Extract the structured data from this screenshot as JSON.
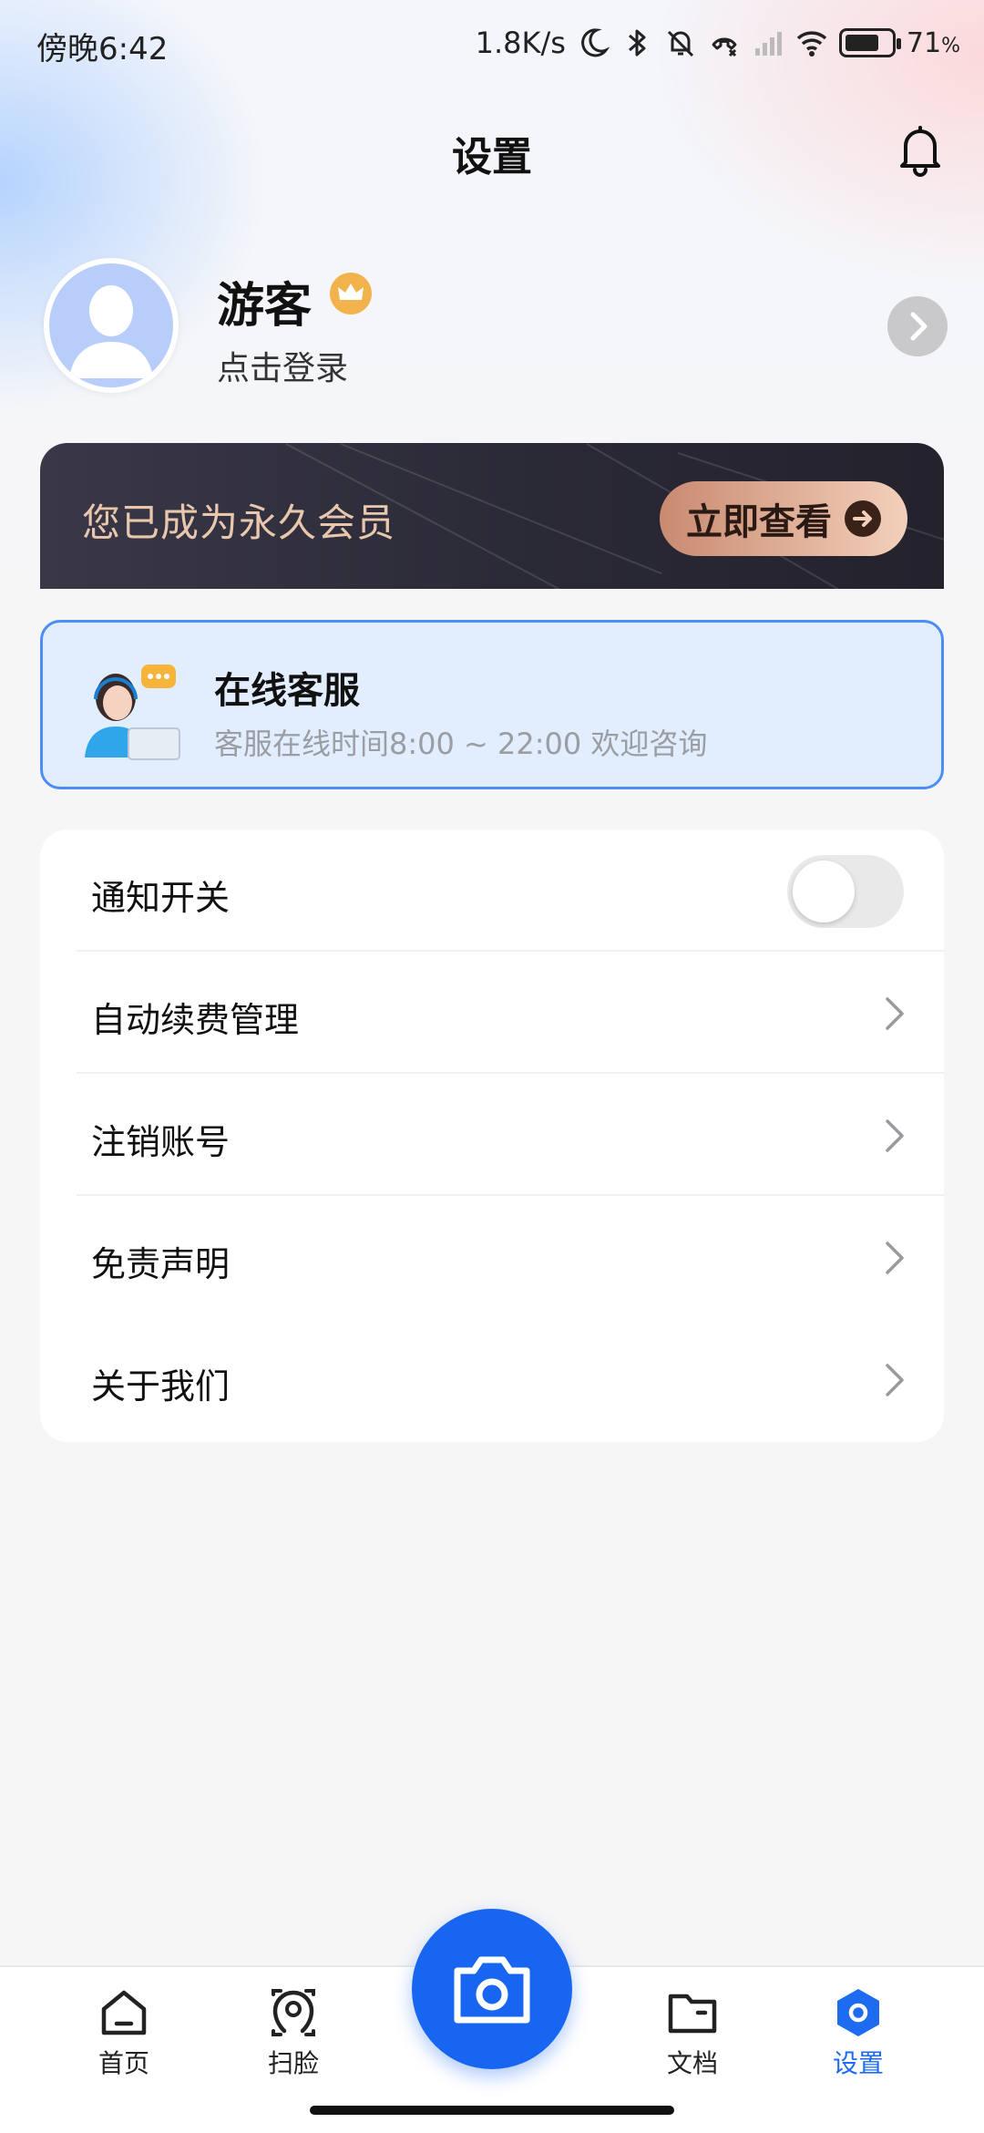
{
  "status_bar": {
    "time": "傍晚6:42",
    "net_speed": "1.8K/s",
    "battery_pct": "71",
    "battery_unit": "%",
    "battery_level": 0.71,
    "icons": [
      "moon-icon",
      "bluetooth-icon",
      "mute-bell-icon",
      "call-off-icon",
      "signal-icon",
      "wifi-icon",
      "battery-icon"
    ]
  },
  "header": {
    "title": "设置",
    "bell_icon": "bell-icon"
  },
  "profile": {
    "name": "游客",
    "login_prompt": "点击登录",
    "badge_icon": "crown-icon"
  },
  "vip_banner": {
    "text": "您已成为永久会员",
    "button_label": "立即查看"
  },
  "service": {
    "title": "在线客服",
    "subtitle": "客服在线时间8:00 ~ 22:00 欢迎咨询"
  },
  "settings": {
    "items": [
      {
        "label": "通知开关",
        "type": "toggle",
        "on": false
      },
      {
        "label": "自动续费管理",
        "type": "link"
      },
      {
        "label": "注销账号",
        "type": "link"
      },
      {
        "label": "免责声明",
        "type": "link"
      },
      {
        "label": "关于我们",
        "type": "link"
      }
    ]
  },
  "nav": {
    "items": [
      {
        "label": "首页",
        "icon": "home-icon"
      },
      {
        "label": "扫脸",
        "icon": "face-scan-icon"
      },
      {
        "label": "文档",
        "icon": "folder-icon"
      },
      {
        "label": "设置",
        "icon": "settings-icon",
        "active": true
      }
    ],
    "camera_icon": "camera-icon"
  },
  "colors": {
    "accent": "#1765f1",
    "vip_text": "#e9c7ad",
    "service_border": "#4c8ef5"
  }
}
